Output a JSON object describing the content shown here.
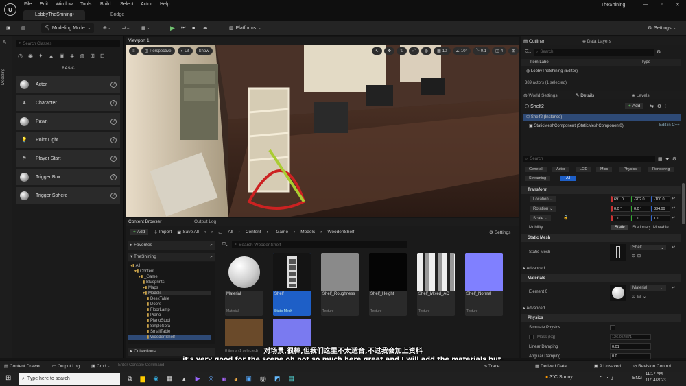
{
  "window": {
    "tab": "LobbyTheShining•",
    "tab2": "Bridge",
    "project": "TheShining",
    "menu": [
      "File",
      "Edit",
      "Window",
      "Tools",
      "Build",
      "Select",
      "Actor",
      "Help"
    ]
  },
  "toolbar": {
    "mode": "Modeling Mode",
    "platforms": "Platforms",
    "settings": "Settings"
  },
  "left": {
    "search_placeholder": "Search Classes",
    "category": "BASIC",
    "side_label": "Modeling",
    "items": [
      "Actor",
      "Character",
      "Pawn",
      "Point Light",
      "Player Start",
      "Trigger Box",
      "Trigger Sphere"
    ]
  },
  "viewport": {
    "tab": "Viewport 1",
    "perspective": "Perspective",
    "lit": "Lit",
    "show": "Show",
    "snap1": "10",
    "snap2": "10°",
    "snap3": "0.1",
    "snap4": "4"
  },
  "content_browser": {
    "tab": "Content Browser",
    "tab2": "Output Log",
    "add": "Add",
    "import": "Import",
    "save_all": "Save All",
    "path": [
      "All",
      "Content",
      "_Game",
      "Models",
      "WoodenShelf"
    ],
    "settings": "Settings",
    "favorites": "Favorites",
    "project": "TheShining",
    "search_placeholder": "Search WoodenShelf",
    "collections": "Collections",
    "status": "8 items (1 selected)",
    "tree": [
      "All",
      "Content",
      "_Game",
      "Blueprints",
      "Maps",
      "Models",
      "DeskTable",
      "Doors",
      "FloorLamp",
      "Piano",
      "PianoStool",
      "SingleSofa",
      "SmallTable",
      "WoodenShelf"
    ],
    "assets": [
      {
        "name": "Material",
        "type": "Material"
      },
      {
        "name": "Shelf",
        "type": "Static Mesh"
      },
      {
        "name": "Shelf_Roughness",
        "type": "Texture"
      },
      {
        "name": "Shelf_Height",
        "type": "Texture"
      },
      {
        "name": "Shelf_Mixed_AO",
        "type": "Texture"
      },
      {
        "name": "Shelf_Normal",
        "type": "Texture"
      }
    ]
  },
  "outliner": {
    "tab": "Outliner",
    "tab2": "Data Layers",
    "search_placeholder": "Search",
    "col1": "Item Label",
    "col2": "Type",
    "item": "LobbyTheShining (Editor)",
    "count": "389 actors (1 selected)"
  },
  "details": {
    "tab0": "World Settings",
    "tab": "Details",
    "tab2": "Levels",
    "actor": "Shelf2",
    "add": "Add",
    "instance": "Shelf2 (Instance)",
    "component": "StaticMeshComponent (StaticMeshComponent0)",
    "edit_cpp": "Edit in C++",
    "search_placeholder": "Search",
    "filters": [
      "General",
      "Actor",
      "LOD",
      "Misc",
      "Physics",
      "Rendering",
      "Streaming",
      "All"
    ],
    "transform": "Transform",
    "location": "Location",
    "rotation": "Rotation",
    "scale": "Scale",
    "mobility": "Mobility",
    "loc": [
      "691.0",
      "-202.0",
      "-100.0"
    ],
    "rot": [
      "0.0 °",
      "0.0 °",
      "334.99"
    ],
    "scl": [
      "1.0",
      "1.0",
      "1.0"
    ],
    "mob": [
      "Static",
      "Stationary",
      "Movable"
    ],
    "static_mesh_sec": "Static Mesh",
    "static_mesh": "Static Mesh",
    "mesh_val": "Shelf",
    "advanced": "Advanced",
    "materials_sec": "Materials",
    "element0": "Element 0",
    "mat_val": "Material",
    "advanced2": "Advanced",
    "physics_sec": "Physics",
    "simulate": "Simulate Physics",
    "mass": "Mass (kg)",
    "mass_val": "126.054871",
    "linear": "Linear Damping",
    "linear_val": "0.01",
    "angular": "Angular Damping",
    "angular_val": "0.0"
  },
  "bottom": {
    "content_drawer": "Content Drawer",
    "output_log": "Output Log",
    "cmd": "Cmd",
    "console": "Enter Console Command",
    "trace": "Trace",
    "derived": "Derived Data",
    "unsaved": "9 Unsaved",
    "revision": "Revision Control"
  },
  "subtitle": {
    "zh": "对场景,很棒,但我们这里不太适合,不过我会加上资料",
    "en": "it's very good for the scene oh not so much here great and I will add the materials but,"
  },
  "taskbar": {
    "search": "Type here to search",
    "weather": "3°C  Sunny",
    "lang": "ENG",
    "time": "11:17 AM",
    "date": "11/14/2023"
  }
}
